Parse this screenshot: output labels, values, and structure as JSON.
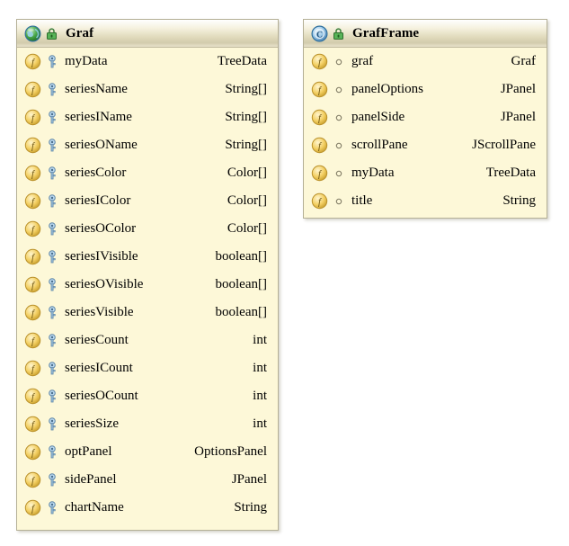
{
  "diagram": {
    "kind": "uml-class-diagram",
    "background": "#ffffff",
    "colors": {
      "box_fill": "#fdf8d8",
      "box_border": "#b5b096",
      "header_top": "#ffffff",
      "header_bottom": "#d2cbac",
      "field_icon": "#f0c040",
      "class_icon_left": "#3a9e3a",
      "class_icon_right": "#4a86c8",
      "lock_icon": "#3f9a3f",
      "key_icon": "#7fa8cc",
      "text": "#000000"
    }
  },
  "classes": [
    {
      "id": "graf",
      "name": "Graf",
      "icon": "class-globe-icon",
      "lock_icon": "lock-icon",
      "members": [
        {
          "name": "myData",
          "type": "TreeData",
          "icon": "field-icon",
          "modifier_icon": "key-icon"
        },
        {
          "name": "seriesName",
          "type": "String[]",
          "icon": "field-icon",
          "modifier_icon": "key-icon"
        },
        {
          "name": "seriesIName",
          "type": "String[]",
          "icon": "field-icon",
          "modifier_icon": "key-icon"
        },
        {
          "name": "seriesOName",
          "type": "String[]",
          "icon": "field-icon",
          "modifier_icon": "key-icon"
        },
        {
          "name": "seriesColor",
          "type": "Color[]",
          "icon": "field-icon",
          "modifier_icon": "key-icon"
        },
        {
          "name": "seriesIColor",
          "type": "Color[]",
          "icon": "field-icon",
          "modifier_icon": "key-icon"
        },
        {
          "name": "seriesOColor",
          "type": "Color[]",
          "icon": "field-icon",
          "modifier_icon": "key-icon"
        },
        {
          "name": "seriesIVisible",
          "type": "boolean[]",
          "icon": "field-icon",
          "modifier_icon": "key-icon"
        },
        {
          "name": "seriesOVisible",
          "type": "boolean[]",
          "icon": "field-icon",
          "modifier_icon": "key-icon"
        },
        {
          "name": "seriesVisible",
          "type": "boolean[]",
          "icon": "field-icon",
          "modifier_icon": "key-icon"
        },
        {
          "name": "seriesCount",
          "type": "int",
          "icon": "field-icon",
          "modifier_icon": "key-icon"
        },
        {
          "name": "seriesICount",
          "type": "int",
          "icon": "field-icon",
          "modifier_icon": "key-icon"
        },
        {
          "name": "seriesOCount",
          "type": "int",
          "icon": "field-icon",
          "modifier_icon": "key-icon"
        },
        {
          "name": "seriesSize",
          "type": "int",
          "icon": "field-icon",
          "modifier_icon": "key-icon"
        },
        {
          "name": "optPanel",
          "type": "OptionsPanel",
          "icon": "field-icon",
          "modifier_icon": "key-icon"
        },
        {
          "name": "sidePanel",
          "type": "JPanel",
          "icon": "field-icon",
          "modifier_icon": "key-icon"
        },
        {
          "name": "chartName",
          "type": "String",
          "icon": "field-icon",
          "modifier_icon": "key-icon"
        }
      ]
    },
    {
      "id": "grafframe",
      "name": "GrafFrame",
      "icon": "class-circle-icon",
      "lock_icon": "lock-icon",
      "members": [
        {
          "name": "graf",
          "type": "Graf",
          "icon": "field-icon",
          "modifier_icon": "package-circle-icon"
        },
        {
          "name": "panelOptions",
          "type": "JPanel",
          "icon": "field-icon",
          "modifier_icon": "package-circle-icon"
        },
        {
          "name": "panelSide",
          "type": "JPanel",
          "icon": "field-icon",
          "modifier_icon": "package-circle-icon"
        },
        {
          "name": "scrollPane",
          "type": "JScrollPane",
          "icon": "field-icon",
          "modifier_icon": "package-circle-icon"
        },
        {
          "name": "myData",
          "type": "TreeData",
          "icon": "field-icon",
          "modifier_icon": "package-circle-icon"
        },
        {
          "name": "title",
          "type": "String",
          "icon": "field-icon",
          "modifier_icon": "package-circle-icon"
        }
      ]
    }
  ]
}
